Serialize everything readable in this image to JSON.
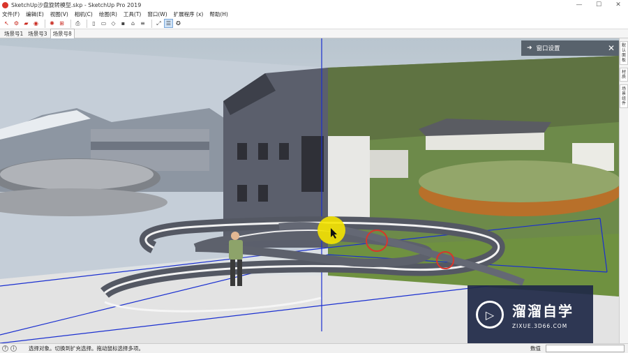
{
  "titlebar": {
    "title": "SketchUp沙盘旋转模型.skp - SketchUp Pro 2019",
    "minimize": "—",
    "maximize": "☐",
    "close": "✕"
  },
  "menu": [
    "文件(F)",
    "编辑(E)",
    "视图(V)",
    "相机(C)",
    "绘图(R)",
    "工具(T)",
    "窗口(W)",
    "扩展程序 (x)",
    "帮助(H)"
  ],
  "scene_tabs": [
    {
      "label": "场景号1",
      "active": false
    },
    {
      "label": "场景号3",
      "active": false
    },
    {
      "label": "场景号8",
      "active": true
    }
  ],
  "viewport_panel": {
    "title": "窗口设置",
    "arrow": "➜",
    "close": "✕"
  },
  "right_panel_tabs": [
    "默认面板",
    "材质",
    "场景 组件"
  ],
  "watermark": {
    "main": "溜溜自学",
    "sub": "ZIXUE.3D66.COM"
  },
  "status": {
    "text": "选择对象。切换到扩充选择。拖动鼠标选择多项。",
    "measure_label": "数值",
    "measure_value": ""
  },
  "colors": {
    "accent_blue": "#1a2fd0",
    "cursor_yellow": "#f5e400",
    "marker_red": "#d9352b"
  }
}
